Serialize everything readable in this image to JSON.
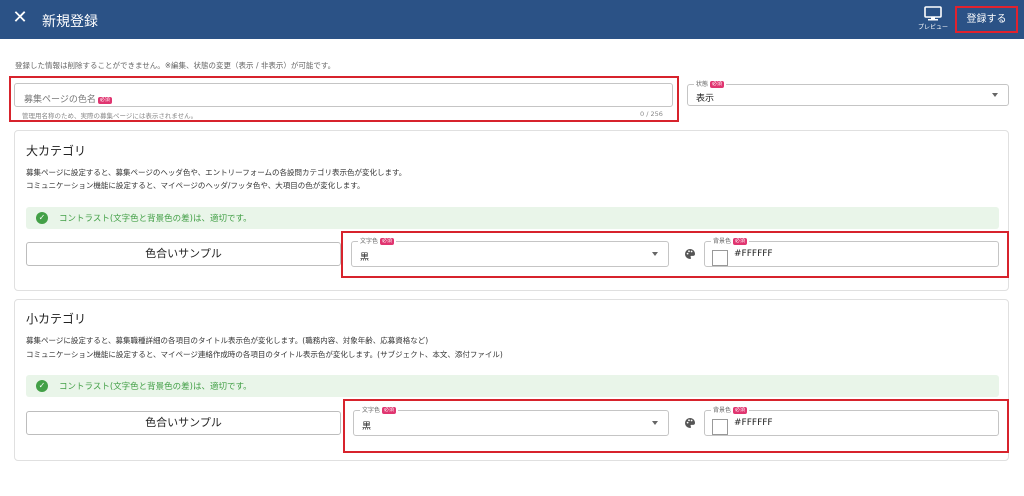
{
  "header": {
    "close_glyph": "✕",
    "title": "新規登録",
    "preview_label": "プレビュー",
    "register_label": "登録する"
  },
  "notice": "登録した情報は削除することができません。※編集、状態の変更（表示 / 非表示）が可能です。",
  "name_field": {
    "placeholder": "募集ページの色名",
    "required": "必須",
    "hint": "管理用名称のため、実際の募集ページには表示されません。",
    "counter": "0 / 256"
  },
  "status_field": {
    "label": "状態",
    "required": "必須",
    "value": "表示"
  },
  "sections": [
    {
      "title": "大カテゴリ",
      "desc1": "募集ページに設定すると、募集ページのヘッダ色や、エントリーフォームの各設問カテゴリ表示色が変化します。",
      "desc2": "コミュニケーション機能に設定すると、マイページのヘッダ/フッタ色や、大項目の色が変化します。",
      "contrast": "コントラスト(文字色と背景色の差)は、適切です。",
      "sample": "色合いサンプル",
      "text_color_label": "文字色",
      "text_color_required": "必須",
      "text_color_value": "黒",
      "bg_color_label": "背景色",
      "bg_color_required": "必須",
      "bg_color_value": "#FFFFFF"
    },
    {
      "title": "小カテゴリ",
      "desc1": "募集ページに設定すると、募集職種詳細の各項目のタイトル表示色が変化します。(職務内容、対象年齢、応募資格など)",
      "desc2": "コミュニケーション機能に設定すると、マイページ連絡作成時の各項目のタイトル表示色が変化します。(サブジェクト、本文、添付ファイル)",
      "contrast": "コントラスト(文字色と背景色の差)は、適切です。",
      "sample": "色合いサンプル",
      "text_color_label": "文字色",
      "text_color_required": "必須",
      "text_color_value": "黒",
      "bg_color_label": "背景色",
      "bg_color_required": "必須",
      "bg_color_value": "#FFFFFF"
    }
  ],
  "colors": {
    "header_bg": "#2b5286",
    "highlight": "#d7232c",
    "success": "#43a047",
    "required_badge": "#e03570"
  }
}
